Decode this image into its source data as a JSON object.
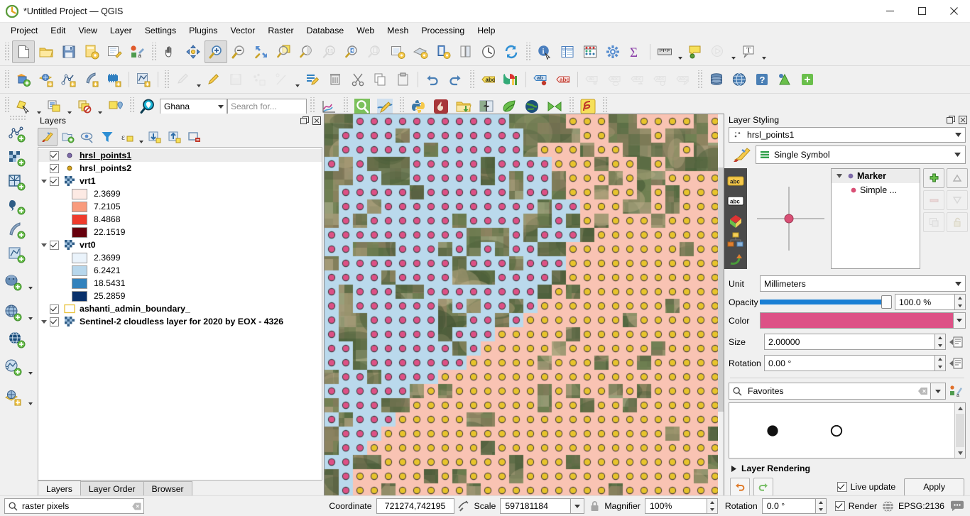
{
  "window": {
    "title": "*Untitled Project — QGIS",
    "logo_icon": "qgis-logo-icon",
    "minimize_label": "—",
    "maximize_label": "❐",
    "close_label": "✕"
  },
  "menubar": {
    "items": [
      {
        "label": "Project"
      },
      {
        "label": "Edit"
      },
      {
        "label": "View"
      },
      {
        "label": "Layer"
      },
      {
        "label": "Settings"
      },
      {
        "label": "Plugins"
      },
      {
        "label": "Vector"
      },
      {
        "label": "Raster"
      },
      {
        "label": "Database"
      },
      {
        "label": "Web"
      },
      {
        "label": "Mesh"
      },
      {
        "label": "Processing"
      },
      {
        "label": "Help"
      }
    ]
  },
  "toolbar_row1": {
    "buttons": [
      {
        "icon": "new-project-icon",
        "state": "active"
      },
      {
        "icon": "open-project-icon"
      },
      {
        "icon": "save-project-icon"
      },
      {
        "icon": "save-project-as-icon"
      },
      {
        "icon": "new-print-layout-icon"
      },
      {
        "icon": "style-manager-icon"
      },
      {
        "icon": "pan-map-icon"
      },
      {
        "icon": "pan-to-selection-icon"
      },
      {
        "icon": "zoom-in-icon",
        "state": "active"
      },
      {
        "icon": "zoom-out-icon"
      },
      {
        "icon": "zoom-full-icon"
      },
      {
        "icon": "zoom-to-selection-icon"
      },
      {
        "icon": "zoom-to-layer-icon"
      },
      {
        "icon": "zoom-native-resolution-icon",
        "state": "disabled"
      },
      {
        "icon": "zoom-last-icon"
      },
      {
        "icon": "zoom-next-icon",
        "state": "disabled"
      },
      {
        "icon": "new-map-view-icon"
      },
      {
        "icon": "new-3d-map-view-icon"
      },
      {
        "icon": "new-print-layout2-icon"
      },
      {
        "icon": "layout-manager-icon"
      },
      {
        "icon": "temporal-controller-icon"
      },
      {
        "icon": "refresh-icon"
      },
      {
        "icon": "identify-features-icon"
      },
      {
        "icon": "open-attribute-table-icon"
      },
      {
        "icon": "statistical-summary-icon"
      },
      {
        "icon": "processing-toolbox-icon"
      },
      {
        "icon": "sum-expression-icon"
      },
      {
        "icon": "measure-line-icon"
      },
      {
        "icon": "map-tips-icon"
      },
      {
        "icon": "run-feature-action-icon",
        "state": "disabled"
      },
      {
        "icon": "new-text-annotation-icon"
      }
    ]
  },
  "toolbar_row2": {
    "buttons": [
      {
        "icon": "add-vector-layer-icon"
      },
      {
        "icon": "open-data-source-manager-icon"
      },
      {
        "icon": "add-geometry-layer-icon"
      },
      {
        "icon": "add-feather-layer-icon"
      },
      {
        "icon": "add-mesh-layer-icon"
      },
      {
        "icon": "new-shapefile-layer-icon"
      },
      {
        "icon": "current-edits-icon",
        "state": "disabled"
      },
      {
        "icon": "toggle-editing-icon"
      },
      {
        "icon": "save-layer-edits-icon",
        "state": "disabled"
      },
      {
        "icon": "add-point-feature-icon",
        "state": "disabled"
      },
      {
        "icon": "vertex-tool-icon",
        "state": "disabled"
      },
      {
        "icon": "modify-attributes-icon"
      },
      {
        "icon": "delete-selected-icon"
      },
      {
        "icon": "cut-features-icon"
      },
      {
        "icon": "copy-features-icon"
      },
      {
        "icon": "paste-features-icon"
      },
      {
        "icon": "undo-icon"
      },
      {
        "icon": "redo-icon"
      },
      {
        "icon": "label-layer-icon"
      },
      {
        "icon": "diagram-layer-icon"
      },
      {
        "icon": "highlight-pinned-labels-icon"
      },
      {
        "icon": "pin-labels-icon"
      },
      {
        "icon": "show-hide-labels-icon",
        "state": "disabled"
      },
      {
        "icon": "move-label-icon",
        "state": "disabled"
      },
      {
        "icon": "rotate-label-icon",
        "state": "disabled"
      },
      {
        "icon": "change-label-icon",
        "state": "disabled"
      },
      {
        "icon": "label-properties-icon",
        "state": "disabled"
      },
      {
        "icon": "database-manager-icon"
      },
      {
        "icon": "osm-download-icon"
      },
      {
        "icon": "help-icon"
      },
      {
        "icon": "plugin-manager-icon"
      },
      {
        "icon": "python-plugin-icon"
      }
    ]
  },
  "toolbar_row3": {
    "buttons_left": [
      {
        "icon": "select-features-icon"
      },
      {
        "icon": "select-value-icon"
      },
      {
        "icon": "deselect-features-icon"
      },
      {
        "icon": "select-by-location-icon"
      }
    ],
    "geocoder": {
      "icon": "geocoder-search-icon",
      "country_value": "Ghana",
      "search_placeholder": "Search for..."
    },
    "buttons_right": [
      {
        "icon": "plot-chart-icon"
      },
      {
        "icon": "magnifier-search-icon"
      },
      {
        "icon": "map-styling-icon"
      },
      {
        "icon": "python-console-icon"
      },
      {
        "icon": "freehand-raster-icon"
      },
      {
        "icon": "open-folder-green-icon"
      },
      {
        "icon": "swipe-tool-icon"
      },
      {
        "icon": "qgis-leaf-icon"
      },
      {
        "icon": "globe-dark-icon"
      },
      {
        "icon": "green-bowtie-icon"
      },
      {
        "icon": "red-trace-icon"
      }
    ]
  },
  "data_source_toolbar": {
    "buttons": [
      {
        "icon": "add-vector-layer-icon"
      },
      {
        "icon": "add-raster-layer-icon"
      },
      {
        "icon": "add-mesh-layer-icon"
      },
      {
        "icon": "add-delimited-text-layer-icon"
      },
      {
        "icon": "add-spatialite-layer-icon"
      },
      {
        "icon": "add-vector-tile-layer-icon"
      },
      {
        "icon": "add-postgis-layer-icon",
        "has_menu": true
      },
      {
        "icon": "add-wms-layer-icon",
        "has_menu": true
      },
      {
        "icon": "add-wfs-layer-icon"
      },
      {
        "icon": "add-arcgis-layer-icon",
        "has_menu": true
      },
      {
        "icon": "add-3d-layer-icon",
        "has_menu": true
      }
    ]
  },
  "layers_panel": {
    "title": "Layers",
    "undock_icon": "undock-icon",
    "close_icon": "close-icon",
    "toolbar": [
      {
        "icon": "open-layer-styling-panel-icon",
        "state": "on"
      },
      {
        "icon": "add-group-icon"
      },
      {
        "icon": "manage-map-themes-icon"
      },
      {
        "icon": "filter-legend-icon"
      },
      {
        "icon": "filter-legend-expression-icon",
        "has_menu": true
      },
      {
        "icon": "expand-all-icon"
      },
      {
        "icon": "collapse-all-icon"
      },
      {
        "icon": "remove-layer-icon"
      }
    ],
    "tabs": [
      {
        "label": "Layers",
        "active": true
      },
      {
        "label": "Layer Order",
        "active": false
      },
      {
        "label": "Browser",
        "active": false
      }
    ],
    "tree": [
      {
        "type": "vector-point",
        "name": "hrsl_points1",
        "checked": true,
        "selected": true,
        "underline": true,
        "expandable": false,
        "symbol_color": "#7d6aa8"
      },
      {
        "type": "vector-point",
        "name": "hrsl_points2",
        "checked": true,
        "selected": false,
        "underline": false,
        "expandable": false,
        "symbol_color": "#d9a520"
      },
      {
        "type": "raster",
        "name": "vrt1",
        "checked": true,
        "selected": false,
        "underline": false,
        "expandable": true,
        "legend": [
          {
            "value": "2.3699",
            "color": "#fdeae4"
          },
          {
            "value": "7.2105",
            "color": "#f99b7d"
          },
          {
            "value": "8.4868",
            "color": "#ef3b2c"
          },
          {
            "value": "22.1519",
            "color": "#67000d"
          }
        ]
      },
      {
        "type": "raster",
        "name": "vrt0",
        "checked": true,
        "selected": false,
        "underline": false,
        "expandable": true,
        "legend": [
          {
            "value": "2.3699",
            "color": "#eaf3fb"
          },
          {
            "value": "6.2421",
            "color": "#b7d7ec"
          },
          {
            "value": "18.5431",
            "color": "#3282bd"
          },
          {
            "value": "25.2859",
            "color": "#08306b"
          }
        ]
      },
      {
        "type": "polygon-outline",
        "name": "ashanti_admin_boundary_",
        "checked": true,
        "selected": false,
        "underline": false,
        "expandable": false,
        "symbol_color": "#e8c13a"
      },
      {
        "type": "raster",
        "name": "Sentinel-2 cloudless layer for 2020 by EOX - 4326",
        "checked": true,
        "selected": false,
        "underline": false,
        "expandable": true
      }
    ]
  },
  "layer_styling": {
    "title": "Layer Styling",
    "undock_icon": "undock-icon",
    "close_icon": "close-icon",
    "selected_layer": "hrsl_points1",
    "layer_icon": "point-layer-icon",
    "renderer": "Single Symbol",
    "renderer_icon": "single-symbol-icon",
    "sidebar_tabs": [
      {
        "icon": "labels-icon"
      },
      {
        "icon": "masks-icon"
      },
      {
        "icon": "3d-view-icon"
      },
      {
        "icon": "diagrams-icon"
      },
      {
        "icon": "actions-icon"
      }
    ],
    "symbol_tree": [
      {
        "label": "Marker",
        "level": 0,
        "color": "#7d6aa8",
        "bold": true
      },
      {
        "label": "Simple ...",
        "level": 1,
        "color": "#d94f75",
        "bold": false
      }
    ],
    "side_buttons": [
      {
        "icon": "add-symbol-layer-icon",
        "state": "enabled"
      },
      {
        "icon": "move-up-icon",
        "state": "disabled"
      },
      {
        "icon": "remove-symbol-layer-icon",
        "state": "disabled"
      },
      {
        "icon": "move-down-icon",
        "state": "disabled"
      },
      {
        "icon": "duplicate-symbol-layer-icon",
        "state": "disabled"
      },
      {
        "icon": "lock-layer-colors-icon",
        "state": "disabled"
      }
    ],
    "fields": {
      "unit_label": "Unit",
      "unit_value": "Millimeters",
      "opacity_label": "Opacity",
      "opacity_value": "100.0 %",
      "opacity_percent": 100,
      "color_label": "Color",
      "color_value": "#dd5186",
      "size_label": "Size",
      "size_value": "2.00000",
      "rotation_label": "Rotation",
      "rotation_value": "0.00 °"
    },
    "symbol_library": {
      "search_icon": "search-icon",
      "filter_value": "Favorites",
      "clear_icon": "clear-icon",
      "style_manager_icon": "style-manager-icon",
      "items": [
        {
          "name": "filled-circle-symbol"
        },
        {
          "name": "hollow-circle-symbol"
        }
      ]
    },
    "layer_rendering_label": "Layer Rendering",
    "undo_icon": "undo-icon",
    "redo_icon": "redo-icon",
    "live_update_label": "Live update",
    "live_update_checked": true,
    "apply_label": "Apply"
  },
  "statusbar": {
    "locator_placeholder": "raster pixels",
    "locator_icon": "search-icon",
    "locator_clear_icon": "clear-icon",
    "coordinate_label": "Coordinate",
    "coordinate_value": "721274,742195",
    "toggle_extents_icon": "toggle-extents-icon",
    "scale_label": "Scale",
    "scale_value": "597181184",
    "lock_icon": "lock-scale-icon",
    "magnifier_label": "Magnifier",
    "magnifier_value": "100%",
    "rotation_label": "Rotation",
    "rotation_value": "0.0 °",
    "render_label": "Render",
    "render_checked": true,
    "crs_icon": "crs-globe-icon",
    "crs_value": "EPSG:2136",
    "messages_icon": "messages-icon"
  },
  "map": {
    "basemap": "Sentinel-2 satellite imagery",
    "cell_colors": {
      "blue_cell": "#bad9ec",
      "salmon_cell": "#f9c3b3"
    },
    "point_colors": {
      "hrsl_points1": "#dd5186",
      "hrsl_points2": "#e8c42c"
    },
    "cell_size_px": 20
  }
}
